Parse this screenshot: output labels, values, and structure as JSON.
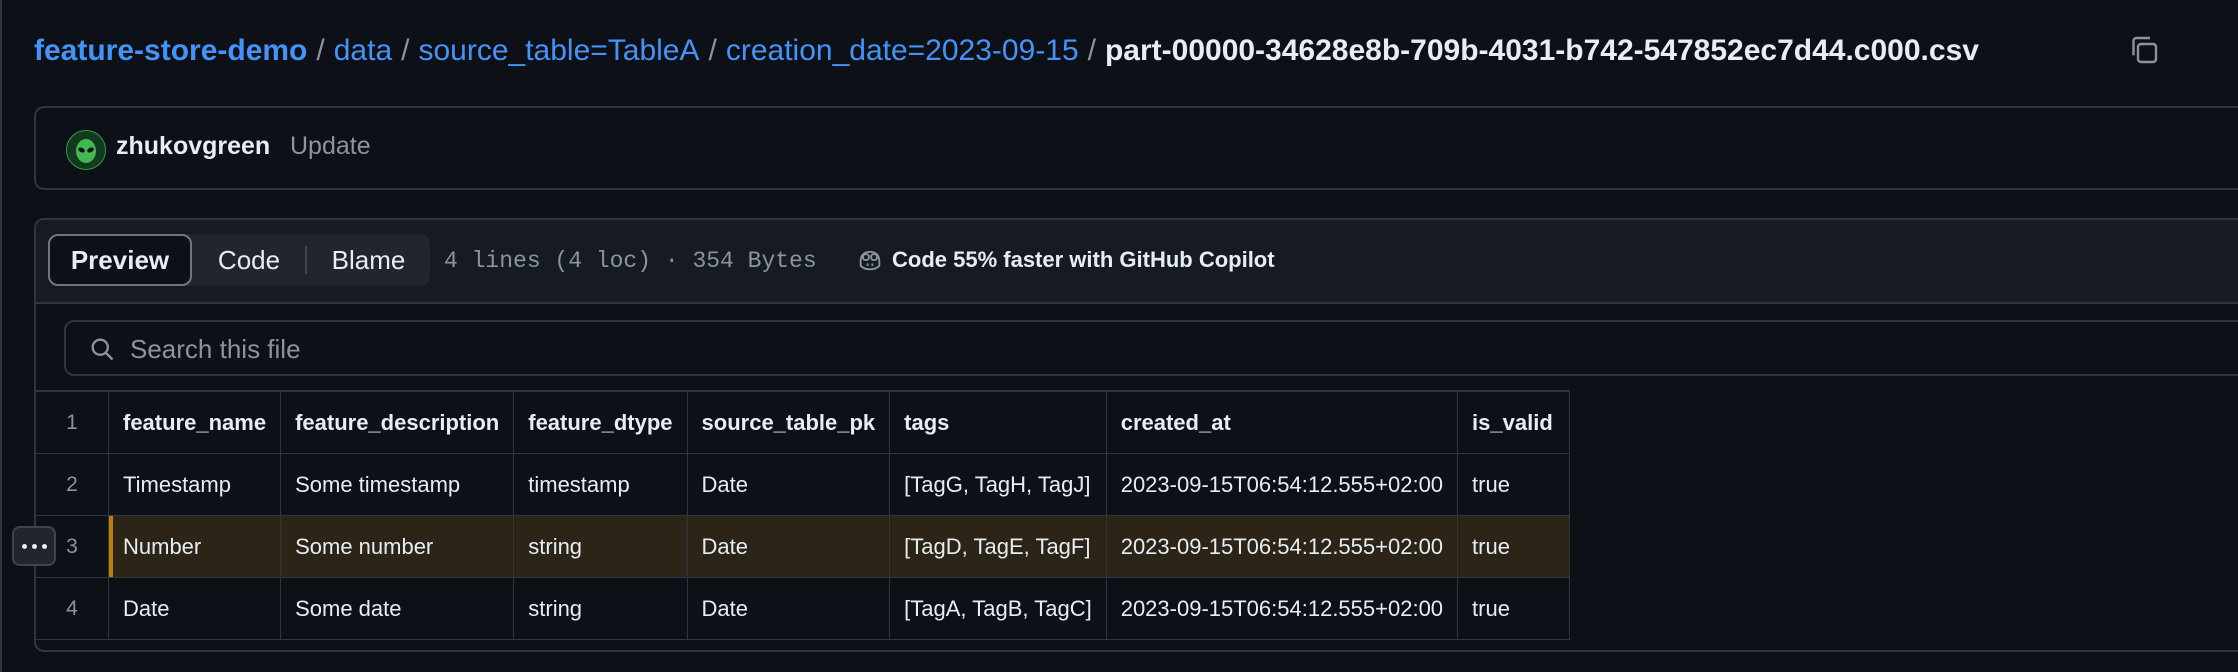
{
  "breadcrumb": {
    "repo": "feature-store-demo",
    "parts": [
      "data",
      "source_table=TableA",
      "creation_date=2023-09-15"
    ],
    "separator": "/",
    "file": "part-00000-34628e8b-709b-4031-b742-547852ec7d44.c000.csv"
  },
  "commit": {
    "author": "zhukovgreen",
    "message": "Update"
  },
  "file_header": {
    "tabs": [
      "Preview",
      "Code",
      "Blame"
    ],
    "active_tab": "Preview",
    "meta": "4 lines (4 loc) · 354 Bytes",
    "copilot": "Code 55% faster with GitHub Copilot"
  },
  "search": {
    "placeholder": "Search this file"
  },
  "table": {
    "line_numbers": [
      "1",
      "2",
      "3",
      "4"
    ],
    "header": [
      "feature_name",
      "feature_description",
      "feature_dtype",
      "source_table_pk",
      "tags",
      "created_at",
      "is_valid"
    ],
    "rows": [
      [
        "Timestamp",
        "Some timestamp",
        "timestamp",
        "Date",
        "[TagG, TagH, TagJ]",
        "2023-09-15T06:54:12.555+02:00",
        "true"
      ],
      [
        "Number",
        "Some number",
        "string",
        "Date",
        "[TagD, TagE, TagF]",
        "2023-09-15T06:54:12.555+02:00",
        "true"
      ],
      [
        "Date",
        "Some date",
        "string",
        "Date",
        "[TagA, TagB, TagC]",
        "2023-09-15T06:54:12.555+02:00",
        "true"
      ]
    ],
    "highlighted_line": "3"
  },
  "colors": {
    "background": "#0d1117",
    "link": "#4493f8",
    "highlight_row": "#2b2417",
    "highlight_marker": "#bb8009",
    "border": "#30363d"
  },
  "icons": [
    "copy-icon",
    "alien-avatar",
    "copilot-icon",
    "search-icon",
    "kebab-menu-icon"
  ]
}
